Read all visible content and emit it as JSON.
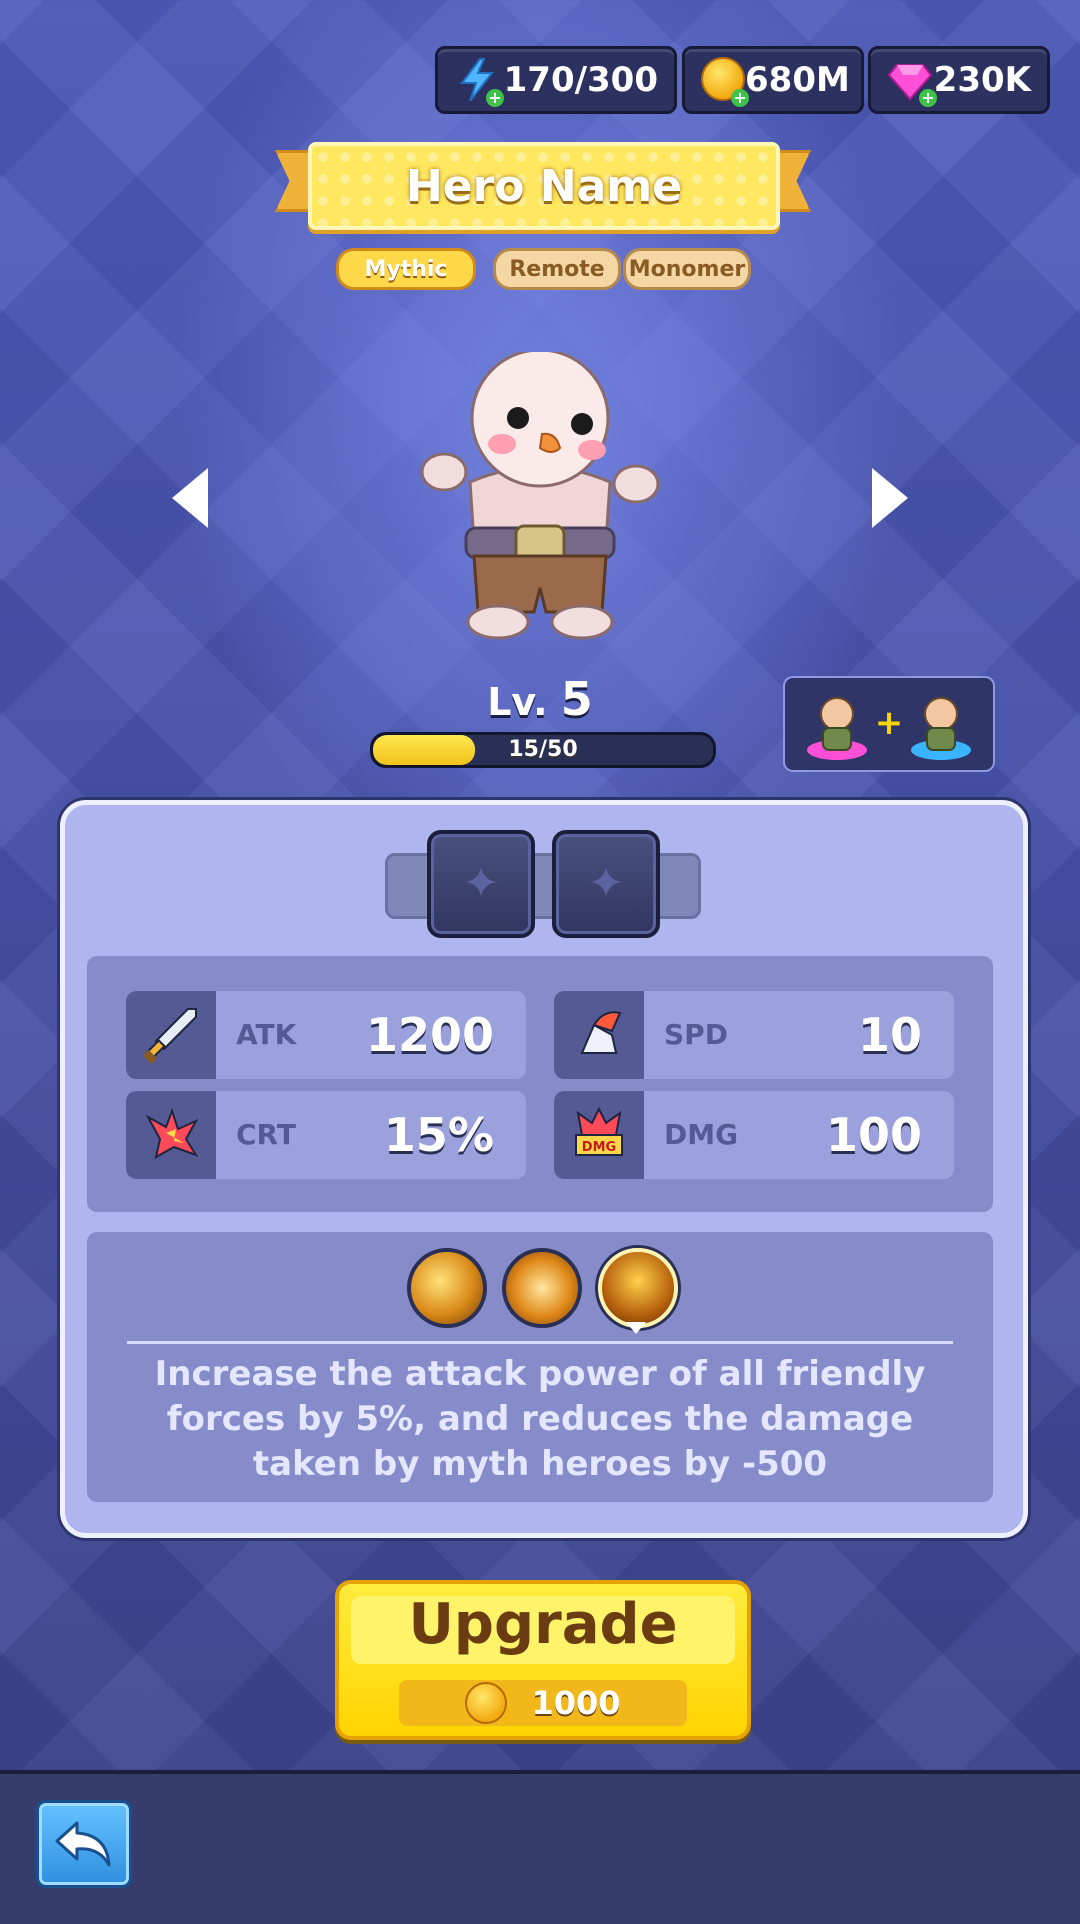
{
  "resources": {
    "energy": {
      "value": "170/300",
      "icon": "lightning-icon"
    },
    "gold": {
      "value": "680M",
      "icon": "gold-coin-icon"
    },
    "gems": {
      "value": "230K",
      "icon": "gem-icon"
    }
  },
  "hero": {
    "name": "Hero Name",
    "tags": [
      "Mythic",
      "Remote",
      "Monomer"
    ],
    "level_prefix": "Lv.",
    "level": "5",
    "xp_text": "15/50",
    "xp_fraction": 0.3
  },
  "stats": [
    {
      "label": "ATK",
      "value": "1200",
      "icon": "sword-icon"
    },
    {
      "label": "SPD",
      "value": "10",
      "icon": "winged-boot-icon"
    },
    {
      "label": "CRT",
      "value": "15%",
      "icon": "critical-burst-icon"
    },
    {
      "label": "DMG",
      "value": "100",
      "icon": "damage-burst-icon",
      "icon_text": "DMG"
    }
  ],
  "skill_description": "Increase the attack power of all friendly forces by 5%, and reduces the damage taken by myth heroes by -500",
  "upgrade": {
    "label": "Upgrade",
    "cost": "1000"
  },
  "colors": {
    "accent_yellow": "#ffd400",
    "panel": "#aeb5ef",
    "background": "#4853ad"
  }
}
